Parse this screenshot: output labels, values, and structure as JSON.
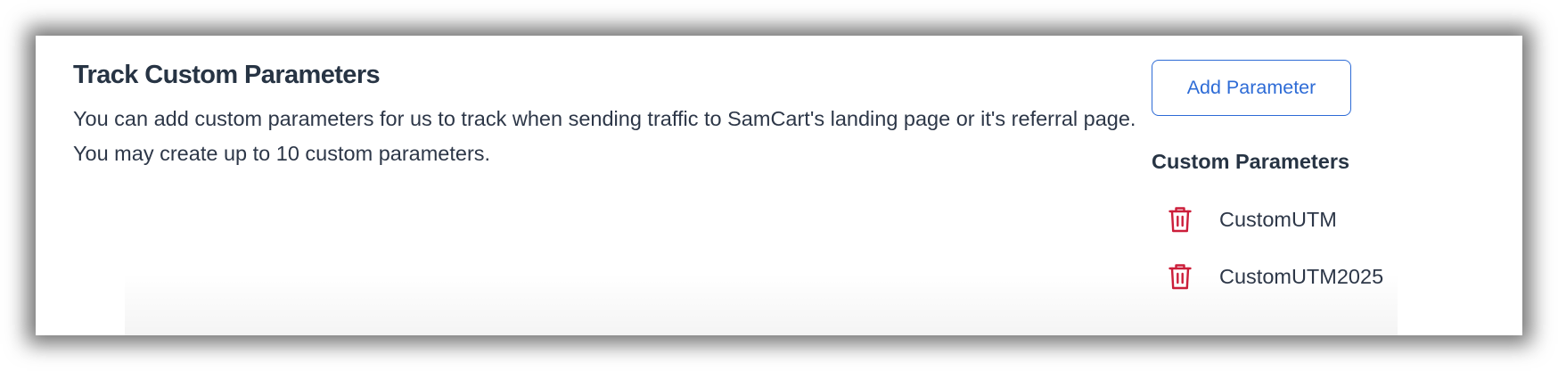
{
  "track": {
    "title": "Track Custom Parameters",
    "description": "You can add custom parameters for us to track when sending traffic to SamCart's landing page or it's referral page. You may create up to 10 custom parameters."
  },
  "actions": {
    "add_label": "Add Parameter"
  },
  "params": {
    "heading": "Custom Parameters",
    "items": [
      {
        "name": "CustomUTM",
        "icon": "trash-icon"
      },
      {
        "name": "CustomUTM2025",
        "icon": "trash-icon"
      }
    ]
  },
  "colors": {
    "accent": "#2d6bd6",
    "danger": "#cc1e3a",
    "heading": "#273444",
    "text": "#2d3748"
  }
}
